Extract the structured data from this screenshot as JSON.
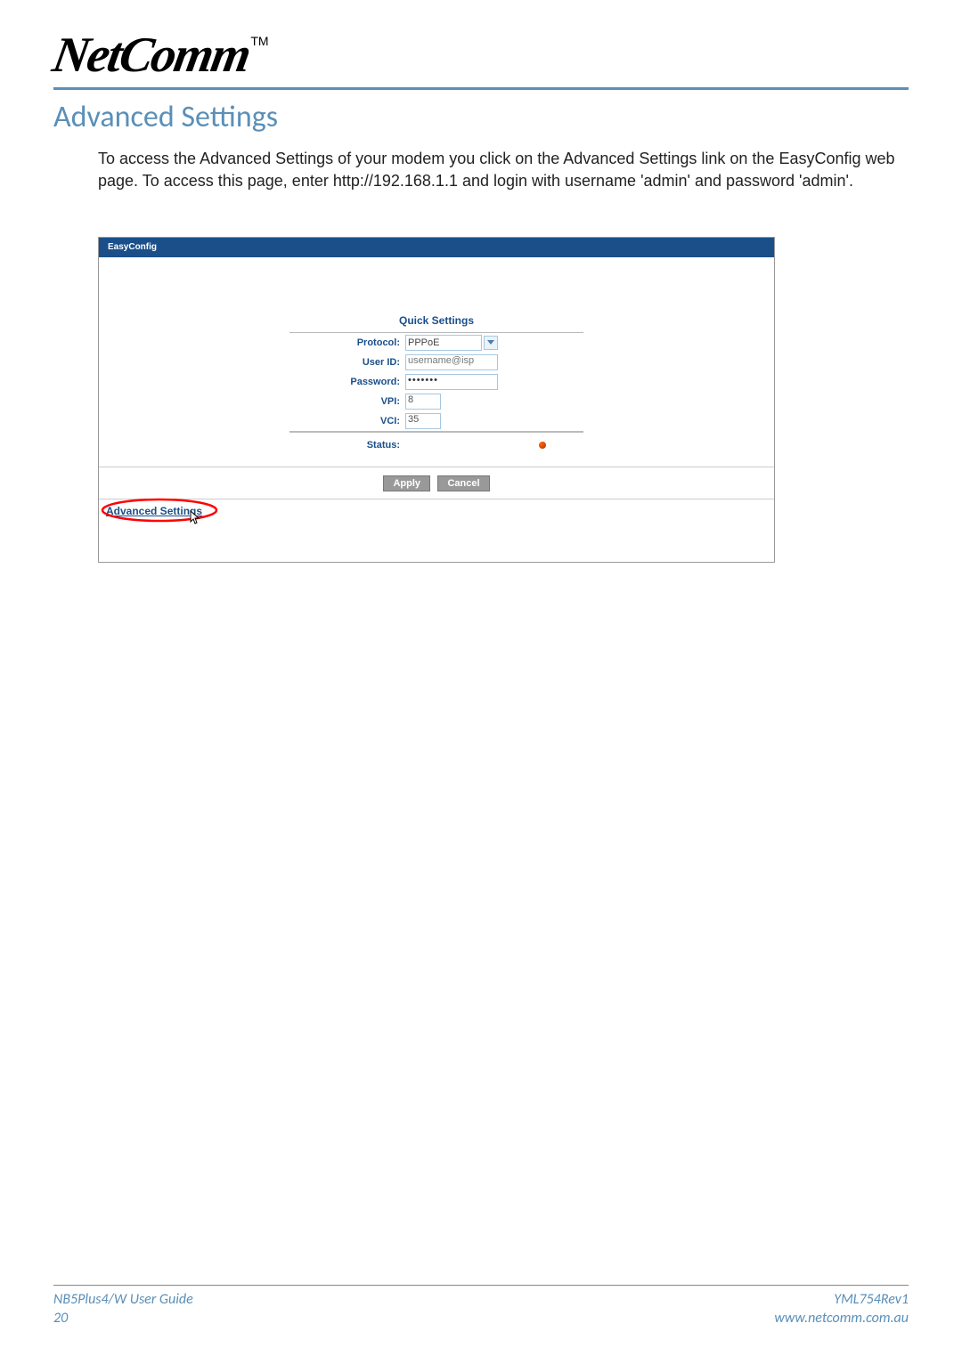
{
  "header": {
    "logo_text": "NetComm",
    "tm": "TM"
  },
  "section": {
    "title": "Advanced Settings",
    "body": "To access the Advanced Settings of your modem you click on the Advanced Settings link on the EasyConfig web page. To access this page, enter http://192.168.1.1 and login with username 'admin' and password 'admin'."
  },
  "screenshot": {
    "tab_label": "EasyConfig",
    "panel_title": "Quick Settings",
    "rows": {
      "protocol_label": "Protocol:",
      "protocol_value": "PPPoE",
      "userid_label": "User ID:",
      "userid_value": "username@isp",
      "password_label": "Password:",
      "password_value": "•••••••",
      "vpi_label": "VPI:",
      "vpi_value": "8",
      "vci_label": "VCI:",
      "vci_value": "35",
      "status_label": "Status:"
    },
    "buttons": {
      "apply": "Apply",
      "cancel": "Cancel"
    },
    "adv_link": "Advanced Settings"
  },
  "footer": {
    "guide": "NB5Plus4/W User Guide",
    "page": "20",
    "rev": "YML754Rev1",
    "url": "www.netcomm.com.au"
  }
}
